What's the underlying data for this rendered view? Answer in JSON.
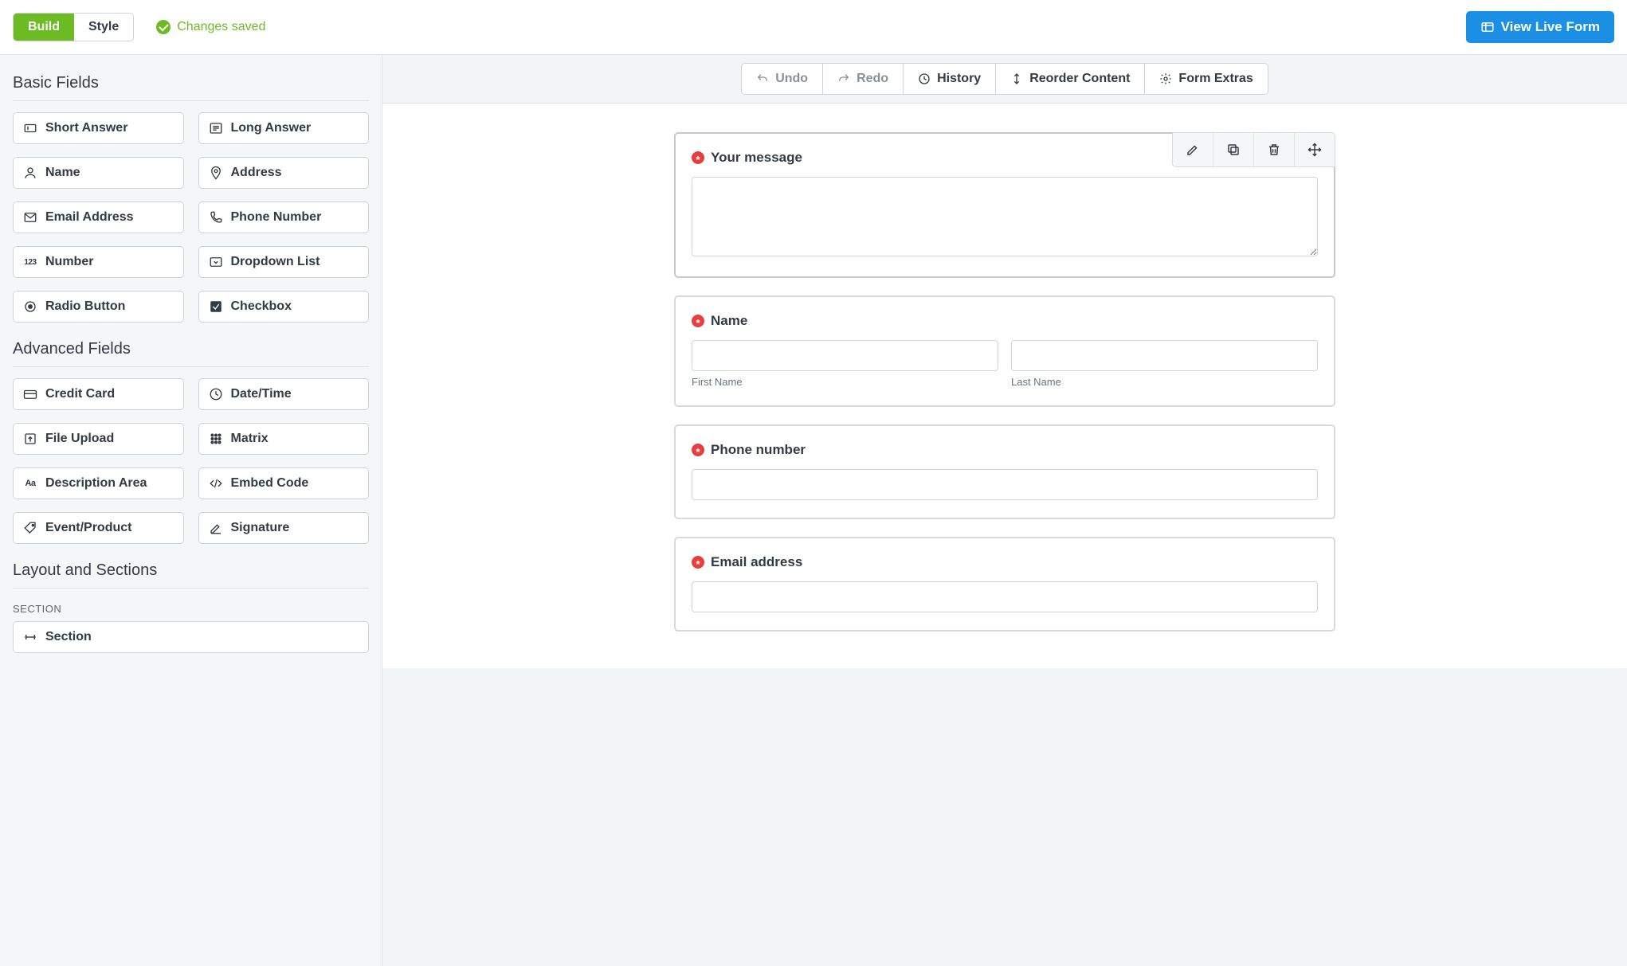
{
  "topbar": {
    "build_label": "Build",
    "style_label": "Style",
    "save_status": "Changes saved",
    "view_live_label": "View Live Form"
  },
  "sidebar": {
    "basic_title": "Basic Fields",
    "advanced_title": "Advanced Fields",
    "layout_title": "Layout and Sections",
    "section_sub": "SECTION",
    "basic": {
      "short_answer": "Short Answer",
      "long_answer": "Long Answer",
      "name": "Name",
      "address": "Address",
      "email_address": "Email Address",
      "phone_number": "Phone Number",
      "number": "Number",
      "dropdown_list": "Dropdown List",
      "radio_button": "Radio Button",
      "checkbox": "Checkbox"
    },
    "advanced": {
      "credit_card": "Credit Card",
      "date_time": "Date/Time",
      "file_upload": "File Upload",
      "matrix": "Matrix",
      "description_area": "Description Area",
      "embed_code": "Embed Code",
      "event_product": "Event/Product",
      "signature": "Signature"
    },
    "layout": {
      "section": "Section"
    }
  },
  "toolbar": {
    "undo": "Undo",
    "redo": "Redo",
    "history": "History",
    "reorder": "Reorder Content",
    "extras": "Form Extras"
  },
  "form": {
    "message_label": "Your message",
    "name_label": "Name",
    "first_name_sub": "First Name",
    "last_name_sub": "Last Name",
    "phone_label": "Phone number",
    "email_label": "Email address"
  }
}
